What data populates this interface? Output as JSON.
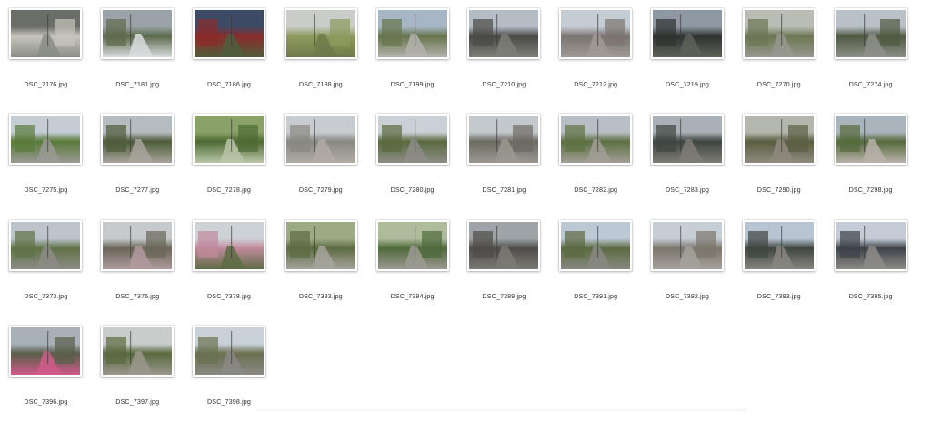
{
  "files": [
    {
      "name": "DSC_7176.jpg",
      "colors": [
        "#6a6d68",
        "#c7c4bc",
        "#8a8e86"
      ]
    },
    {
      "name": "DSC_7181.jpg",
      "colors": [
        "#9aa3a8",
        "#5b6a4c",
        "#d9dcde"
      ]
    },
    {
      "name": "DSC_7186.jpg",
      "colors": [
        "#3d4a66",
        "#8b2b2a",
        "#4f5e3c"
      ]
    },
    {
      "name": "DSC_7188.jpg",
      "colors": [
        "#c9ccc9",
        "#8f9a5e",
        "#6f7a4a"
      ]
    },
    {
      "name": "DSC_7199.jpg",
      "colors": [
        "#a7b6c4",
        "#66754d",
        "#b3b2ad"
      ]
    },
    {
      "name": "DSC_7210.jpg",
      "colors": [
        "#b4bcc6",
        "#4b4a46",
        "#7d7f76"
      ]
    },
    {
      "name": "DSC_7212.jpg",
      "colors": [
        "#c5ccd4",
        "#7a7470",
        "#a19a94"
      ]
    },
    {
      "name": "DSC_7219.jpg",
      "colors": [
        "#8e98a2",
        "#2f3331",
        "#5e6258"
      ]
    },
    {
      "name": "DSC_7270.jpg",
      "colors": [
        "#b9bdb6",
        "#6c7654",
        "#97988f"
      ]
    },
    {
      "name": "DSC_7274.jpg",
      "colors": [
        "#b8c0c8",
        "#4f5a42",
        "#8d8f88"
      ]
    },
    {
      "name": "DSC_7275.jpg",
      "colors": [
        "#c4ccd4",
        "#5a7a3a",
        "#9a9a94"
      ]
    },
    {
      "name": "DSC_7277.jpg",
      "colors": [
        "#b5bcc0",
        "#4d5c3a",
        "#a8a49c"
      ]
    },
    {
      "name": "DSC_7278.jpg",
      "colors": [
        "#8aa268",
        "#4f6a34",
        "#b9c6a8"
      ]
    },
    {
      "name": "DSC_7279.jpg",
      "colors": [
        "#c8ccd0",
        "#8a8882",
        "#b0aca4"
      ]
    },
    {
      "name": "DSC_7280.jpg",
      "colors": [
        "#c9d0d6",
        "#5a6a3e",
        "#8d8c86"
      ]
    },
    {
      "name": "DSC_7281.jpg",
      "colors": [
        "#c2c8cc",
        "#6d6a62",
        "#9b9890"
      ]
    },
    {
      "name": "DSC_7282.jpg",
      "colors": [
        "#b7bec4",
        "#5d7042",
        "#a19e96"
      ]
    },
    {
      "name": "DSC_7283.jpg",
      "colors": [
        "#a9b0b6",
        "#3f4640",
        "#7e7d76"
      ]
    },
    {
      "name": "DSC_7290.jpg",
      "colors": [
        "#b4b7ae",
        "#5b5e42",
        "#8f8a7e"
      ]
    },
    {
      "name": "DSC_7298.jpg",
      "colors": [
        "#aab4bc",
        "#566a3c",
        "#b8b2aa"
      ]
    },
    {
      "name": "DSC_7373.jpg",
      "colors": [
        "#bcc4cc",
        "#5f7246",
        "#8e8c86"
      ]
    },
    {
      "name": "DSC_7375.jpg",
      "colors": [
        "#c6cacc",
        "#6a6658",
        "#b09a9e"
      ]
    },
    {
      "name": "DSC_7378.jpg",
      "colors": [
        "#cdd2d6",
        "#c18a9c",
        "#5e6c44"
      ]
    },
    {
      "name": "DSC_7383.jpg",
      "colors": [
        "#9cab84",
        "#5c6b42",
        "#a6a49c"
      ]
    },
    {
      "name": "DSC_7384.jpg",
      "colors": [
        "#aebc9c",
        "#4f6a3a",
        "#9c9a92"
      ]
    },
    {
      "name": "DSC_7389.jpg",
      "colors": [
        "#9ea4a8",
        "#4e4c48",
        "#7c7a74"
      ]
    },
    {
      "name": "DSC_7391.jpg",
      "colors": [
        "#bcc8d4",
        "#5a6a40",
        "#8a8882"
      ]
    },
    {
      "name": "DSC_7392.jpg",
      "colors": [
        "#c6ced6",
        "#7a766c",
        "#a6a29a"
      ]
    },
    {
      "name": "DSC_7393.jpg",
      "colors": [
        "#b8c4d2",
        "#3f4640",
        "#888680"
      ]
    },
    {
      "name": "DSC_7395.jpg",
      "colors": [
        "#c4ccd8",
        "#3e4248",
        "#8e8c88"
      ]
    },
    {
      "name": "DSC_7396.jpg",
      "colors": [
        "#a8b0b8",
        "#5a5e4a",
        "#d05a8a"
      ]
    },
    {
      "name": "DSC_7397.jpg",
      "colors": [
        "#c8ccca",
        "#5a6a40",
        "#9a968c"
      ]
    },
    {
      "name": "DSC_7398.jpg",
      "colors": [
        "#c8d0d8",
        "#6a7050",
        "#8a8884"
      ]
    }
  ]
}
